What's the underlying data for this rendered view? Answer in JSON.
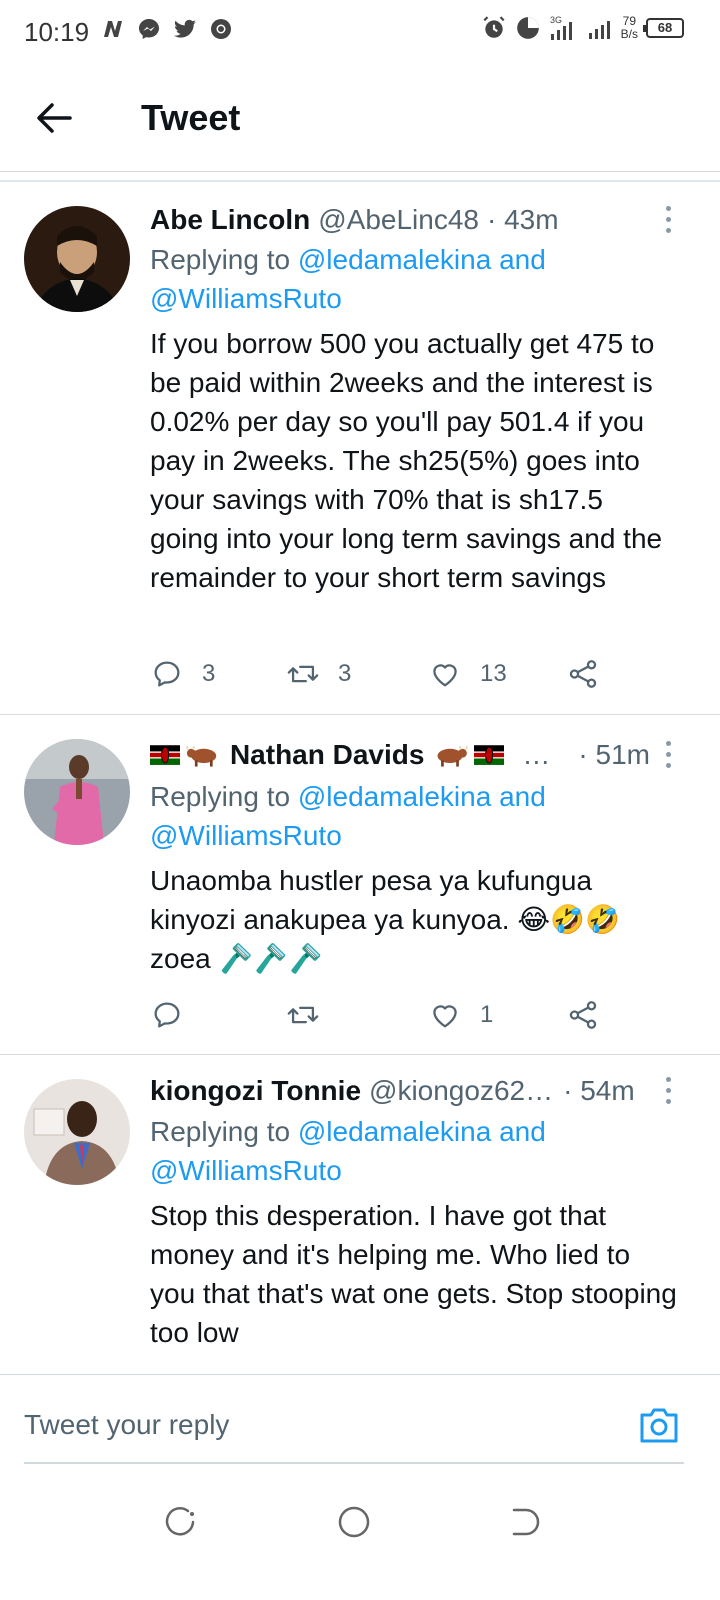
{
  "status_bar": {
    "time": "10:19",
    "netspeed_value": "79",
    "netspeed_unit": "B/s",
    "network": "3G",
    "battery": "68"
  },
  "header": {
    "title": "Tweet"
  },
  "tweets": [
    {
      "name": "Abe Lincoln",
      "handle": "@AbeLinc48",
      "time": "· 43m",
      "replying_prefix": "Replying to",
      "replying_to_1": "@ledamalekina",
      "replying_and": "and",
      "replying_to_2": "@WilliamsRuto",
      "text": "If you borrow 500 you actually get 475 to be paid within 2weeks and the interest is 0.02% per day so you'll pay 501.4 if you pay in 2weeks. The sh25(5%) goes into your savings with 70% that is sh17.5 going into your long term savings and the remainder to your short term savings",
      "replies": "3",
      "retweets": "3",
      "likes": "13"
    },
    {
      "name": "Nathan Davids",
      "name_trunc": "…",
      "time": "· 51m",
      "replying_prefix": "Replying to",
      "replying_to_1": "@ledamalekina",
      "replying_and": "and",
      "replying_to_2": "@WilliamsRuto",
      "text_line1": "Unaomba hustler pesa ya kufungua",
      "text_line2": "kinyozi anakupea ya kunyoa.",
      "text_line2_emoji": "😂🤣🤣",
      "text_line3": "zoea",
      "text_line3_emoji": "🪒🪒🪒",
      "replies": "",
      "retweets": "",
      "likes": "1"
    },
    {
      "name": "kiongozi Tonnie",
      "handle": "@kiongoz62…",
      "time": "· 54m",
      "replying_prefix": "Replying to",
      "replying_to_1": "@ledamalekina",
      "replying_and": "and",
      "replying_to_2": "@WilliamsRuto",
      "text": "Stop this desperation. I have got that money and it's helping me. Who lied to you that that's wat one gets. Stop stooping too low"
    }
  ],
  "reply_bar": {
    "placeholder": "Tweet your reply"
  },
  "colors": {
    "accent": "#1d9bf0",
    "secondary_text": "#536471"
  }
}
